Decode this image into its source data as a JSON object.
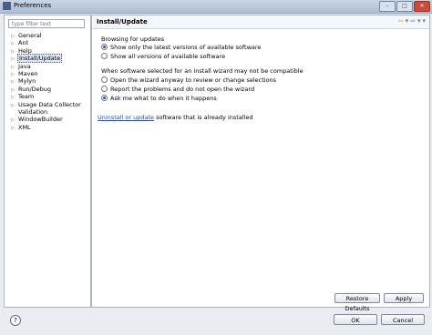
{
  "window": {
    "title": "Preferences"
  },
  "filter": {
    "placeholder": "type filter text"
  },
  "tree": [
    {
      "label": "General",
      "expandable": true
    },
    {
      "label": "Ant",
      "expandable": true
    },
    {
      "label": "Help",
      "expandable": true
    },
    {
      "label": "Install/Update",
      "expandable": true,
      "selected": true
    },
    {
      "label": "Java",
      "expandable": true
    },
    {
      "label": "Maven",
      "expandable": true
    },
    {
      "label": "Mylyn",
      "expandable": true
    },
    {
      "label": "Run/Debug",
      "expandable": true
    },
    {
      "label": "Team",
      "expandable": true
    },
    {
      "label": "Usage Data Collector",
      "expandable": true
    },
    {
      "label": "Validation",
      "expandable": false
    },
    {
      "label": "WindowBuilder",
      "expandable": true
    },
    {
      "label": "XML",
      "expandable": true
    }
  ],
  "page": {
    "title": "Install/Update",
    "browsing": {
      "label": "Browsing for updates",
      "options": [
        "Show only the latest versions of available software",
        "Show all versions of available software"
      ],
      "selected": 0
    },
    "incompat": {
      "label": "When software selected for an install wizard may not be compatible",
      "options": [
        "Open the wizard anyway to review or change selections",
        "Report the problems and do not open the wizard",
        "Ask me what to do when it happens"
      ],
      "selected": 2
    },
    "uninstall": {
      "link": "Uninstall or update",
      "rest": " software that is already installed"
    }
  },
  "buttons": {
    "restore": "Restore Defaults",
    "apply": "Apply",
    "ok": "OK",
    "cancel": "Cancel"
  },
  "help_glyph": "?"
}
